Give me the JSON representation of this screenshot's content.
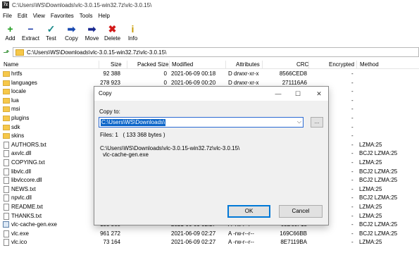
{
  "window": {
    "title": "C:\\Users\\WS\\Downloads\\vlc-3.0.15-win32.7z\\vlc-3.0.15\\",
    "app_icon": "7z"
  },
  "menu": [
    "File",
    "Edit",
    "View",
    "Favorites",
    "Tools",
    "Help"
  ],
  "toolbar": [
    {
      "label": "Add",
      "icon": "plus-icon",
      "glyph": "+",
      "color": "#1a9a1a"
    },
    {
      "label": "Extract",
      "icon": "minus-icon",
      "glyph": "−",
      "color": "#1a3aa8"
    },
    {
      "label": "Test",
      "icon": "check-icon",
      "glyph": "✓",
      "color": "#1a8a8a"
    },
    {
      "label": "Copy",
      "icon": "copy-arrow-icon",
      "glyph": "➡",
      "color": "#1a4ab0"
    },
    {
      "label": "Move",
      "icon": "move-arrow-icon",
      "glyph": "➡",
      "color": "#1a2a90"
    },
    {
      "label": "Delete",
      "icon": "delete-x-icon",
      "glyph": "✖",
      "color": "#d21a1a"
    },
    {
      "label": "Info",
      "icon": "info-icon",
      "glyph": "i",
      "color": "#c89a00"
    }
  ],
  "address": {
    "path": "C:\\Users\\WS\\Downloads\\vlc-3.0.15-win32.7z\\vlc-3.0.15\\"
  },
  "columns": {
    "name": "Name",
    "size": "Size",
    "packed": "Packed Size",
    "modified": "Modified",
    "attributes": "Attributes",
    "crc": "CRC",
    "encrypted": "Encrypted",
    "method": "Method"
  },
  "files": [
    {
      "type": "folder",
      "name": "hrtfs",
      "size": "92 388",
      "packed": "0",
      "modified": "2021-06-09 00:18",
      "attr": "D drwxr-xr-x",
      "crc": "8566CED8",
      "enc": "-",
      "method": ""
    },
    {
      "type": "folder",
      "name": "languages",
      "size": "278 923",
      "packed": "0",
      "modified": "2021-06-09 00:20",
      "attr": "D drwxr-xr-x",
      "crc": "271116A6",
      "enc": "-",
      "method": ""
    },
    {
      "type": "folder",
      "name": "locale",
      "size": "",
      "packed": "",
      "modified": "",
      "attr": "",
      "crc": "",
      "enc": "-",
      "method": ""
    },
    {
      "type": "folder",
      "name": "lua",
      "size": "",
      "packed": "",
      "modified": "",
      "attr": "",
      "crc": "",
      "enc": "-",
      "method": ""
    },
    {
      "type": "folder",
      "name": "msi",
      "size": "",
      "packed": "",
      "modified": "",
      "attr": "",
      "crc": "",
      "enc": "-",
      "method": ""
    },
    {
      "type": "folder",
      "name": "plugins",
      "size": "",
      "packed": "",
      "modified": "",
      "attr": "",
      "crc": "",
      "enc": "-",
      "method": ""
    },
    {
      "type": "folder",
      "name": "sdk",
      "size": "",
      "packed": "",
      "modified": "",
      "attr": "",
      "crc": "",
      "enc": "-",
      "method": ""
    },
    {
      "type": "folder",
      "name": "skins",
      "size": "",
      "packed": "",
      "modified": "",
      "attr": "",
      "crc": "",
      "enc": "-",
      "method": ""
    },
    {
      "type": "file",
      "name": "AUTHORS.txt",
      "size": "",
      "packed": "",
      "modified": "",
      "attr": "",
      "crc": "",
      "enc": "-",
      "method": "LZMA:25"
    },
    {
      "type": "file",
      "name": "axvlc.dll",
      "size": "",
      "packed": "",
      "modified": "",
      "attr": "",
      "crc": "",
      "enc": "-",
      "method": "BCJ2 LZMA:25"
    },
    {
      "type": "file",
      "name": "COPYING.txt",
      "size": "",
      "packed": "",
      "modified": "",
      "attr": "",
      "crc": "",
      "enc": "-",
      "method": "LZMA:25"
    },
    {
      "type": "file",
      "name": "libvlc.dll",
      "size": "",
      "packed": "",
      "modified": "",
      "attr": "",
      "crc": "",
      "enc": "-",
      "method": "BCJ2 LZMA:25"
    },
    {
      "type": "file",
      "name": "libvlccore.dll",
      "size": "",
      "packed": "",
      "modified": "",
      "attr": "",
      "crc": "",
      "enc": "-",
      "method": "BCJ2 LZMA:25"
    },
    {
      "type": "file",
      "name": "NEWS.txt",
      "size": "",
      "packed": "",
      "modified": "",
      "attr": "",
      "crc": "",
      "enc": "-",
      "method": "LZMA:25"
    },
    {
      "type": "file",
      "name": "npvlc.dll",
      "size": "",
      "packed": "",
      "modified": "",
      "attr": "",
      "crc": "",
      "enc": "-",
      "method": "BCJ2 LZMA:25"
    },
    {
      "type": "file",
      "name": "README.txt",
      "size": "",
      "packed": "",
      "modified": "",
      "attr": "",
      "crc": "",
      "enc": "-",
      "method": "LZMA:25"
    },
    {
      "type": "file",
      "name": "THANKS.txt",
      "size": "",
      "packed": "",
      "modified": "",
      "attr": "",
      "crc": "",
      "enc": "-",
      "method": "LZMA:25"
    },
    {
      "type": "exe",
      "name": "vlc-cache-gen.exe",
      "size": "133 368",
      "packed": "",
      "modified": "2021-06-09 02:27",
      "attr": "A -rw-r--r--",
      "crc": "63D60F15",
      "enc": "-",
      "method": "BCJ2 LZMA:25"
    },
    {
      "type": "file",
      "name": "vlc.exe",
      "size": "961 272",
      "packed": "",
      "modified": "2021-06-09 02:27",
      "attr": "A -rw-r--r--",
      "crc": "169C66BB",
      "enc": "-",
      "method": "BCJ2 LZMA:25"
    },
    {
      "type": "file",
      "name": "vlc.ico",
      "size": "73 164",
      "packed": "",
      "modified": "2021-06-09 02:27",
      "attr": "A -rw-r--r--",
      "crc": "8E7119BA",
      "enc": "-",
      "method": "LZMA:25"
    }
  ],
  "dialog": {
    "title": "Copy",
    "copy_to_label": "Copy to:",
    "destination": "C:\\Users\\WS\\Downloads\\",
    "browse_label": "...",
    "files_info": "Files: 1   ( 133 368 bytes )",
    "source_path": "C:\\Users\\WS\\Downloads\\vlc-3.0.15-win32.7z\\vlc-3.0.15\\",
    "source_file": "vlc-cache-gen.exe",
    "ok_label": "OK",
    "cancel_label": "Cancel",
    "minimize": "—",
    "maximize": "☐",
    "close": "✕"
  }
}
